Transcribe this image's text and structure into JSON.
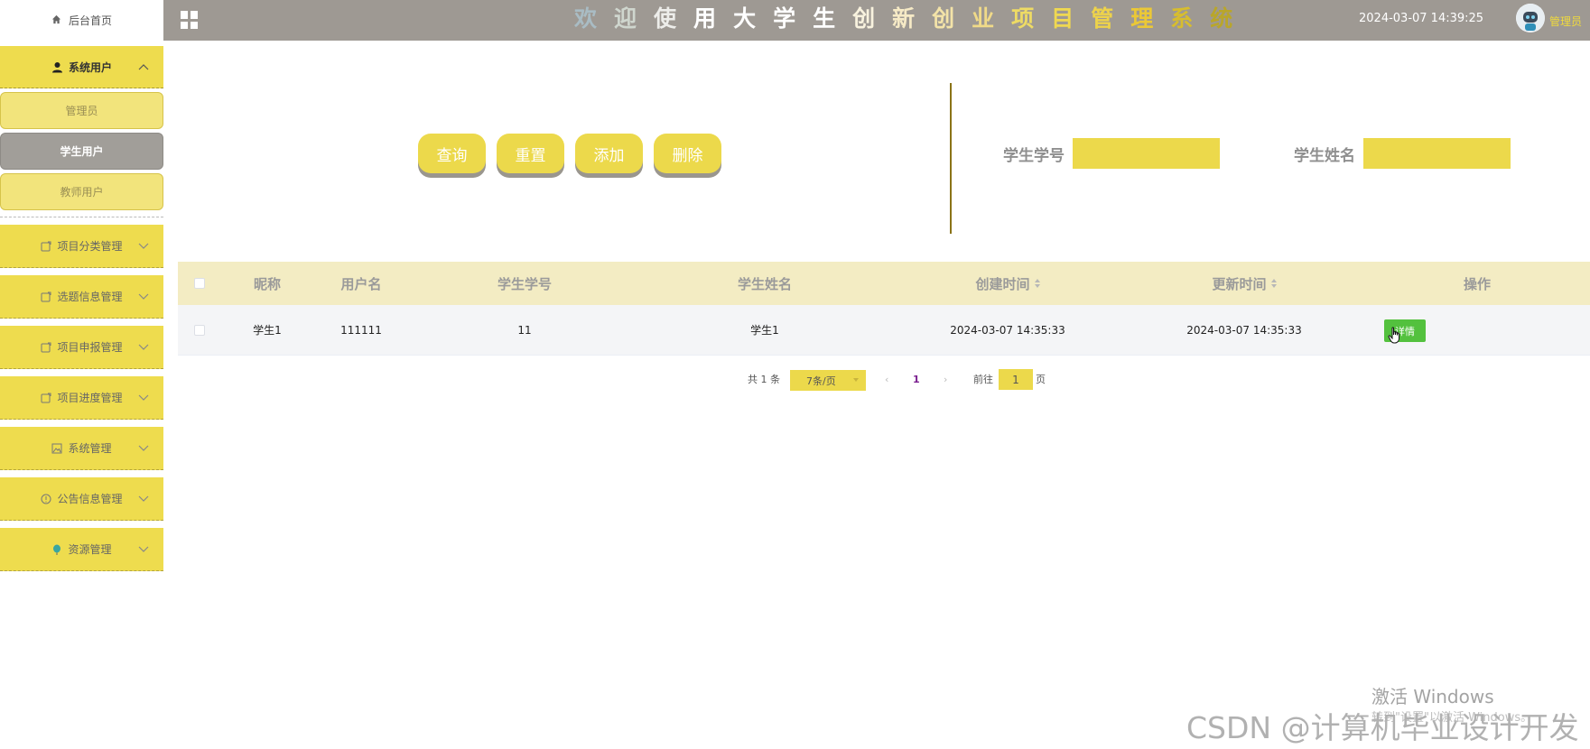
{
  "sidebar": {
    "home_label": "后台首页",
    "group": {
      "label": "系统用户",
      "items": [
        {
          "label": "管理员"
        },
        {
          "label": "学生用户"
        },
        {
          "label": "教师用户"
        }
      ]
    },
    "menus": [
      {
        "label": "项目分类管理",
        "icon": "folder-icon"
      },
      {
        "label": "选题信息管理",
        "icon": "folder-icon"
      },
      {
        "label": "项目申报管理",
        "icon": "folder-icon"
      },
      {
        "label": "项目进度管理",
        "icon": "folder-icon"
      },
      {
        "label": "系统管理",
        "icon": "image-icon"
      },
      {
        "label": "公告信息管理",
        "icon": "info-icon"
      },
      {
        "label": "资源管理",
        "icon": "balloon-icon"
      }
    ]
  },
  "header": {
    "title": "欢迎使用大学生创新创业项目管理系统",
    "datetime": "2024-03-07 14:39:25",
    "user": "管理员",
    "title_colors": [
      "#a9bcc4",
      "#cfd6ce",
      "#ededea",
      "#ffffff",
      "#ffffff",
      "#ffffff",
      "#ffffff",
      "#f8f2de",
      "#f6eac6",
      "#f3e3a8",
      "#f0da88",
      "#eedb64",
      "#efd851",
      "#eed34a",
      "#ebc836",
      "#d7bd2e",
      "#b9a62a"
    ]
  },
  "toolbar": {
    "query": "查询",
    "reset": "重置",
    "add": "添加",
    "delete": "删除"
  },
  "filters": {
    "student_no_label": "学生学号",
    "student_name_label": "学生姓名"
  },
  "table": {
    "headers": {
      "nickname": "昵称",
      "username": "用户名",
      "student_no": "学生学号",
      "student_name": "学生姓名",
      "created": "创建时间",
      "updated": "更新时间",
      "actions": "操作"
    },
    "rows": [
      {
        "nickname": "学生1",
        "username": "111111",
        "student_no": "11",
        "student_name": "学生1",
        "created": "2024-03-07 14:35:33",
        "updated": "2024-03-07 14:35:33",
        "action": "详情"
      }
    ]
  },
  "pagination": {
    "total": "共 1 条",
    "page_size": "7条/页",
    "current_page": "1",
    "goto_prefix": "前往",
    "goto_value": "1",
    "goto_suffix": "页"
  },
  "watermarks": {
    "activate": "激活 Windows",
    "activate_sub": "转到\"设置\"以激活 Windows。",
    "csdn": "CSDN @计算机毕业设计开发"
  },
  "colors": {
    "accent": "#ecd94b",
    "topbar": "#9e9993",
    "active_item": "#a19e99",
    "detail_button": "#53c13e"
  }
}
